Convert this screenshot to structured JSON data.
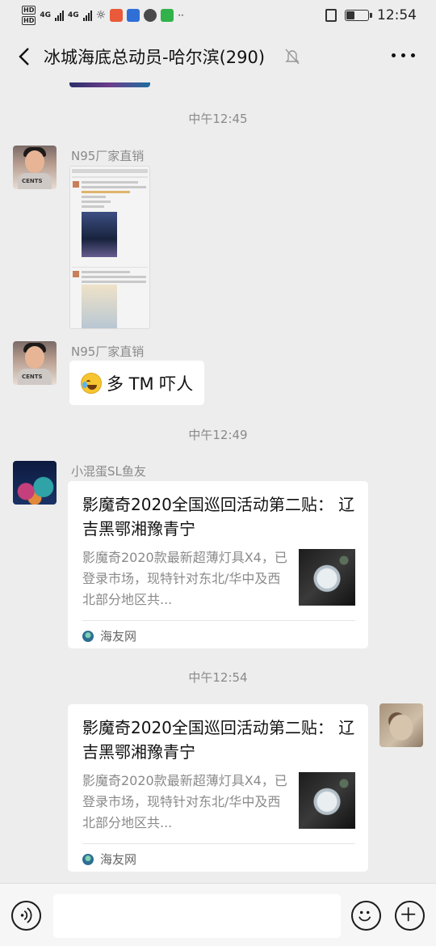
{
  "status_bar": {
    "hd1": "HD",
    "hd2": "HD",
    "net1": "4G",
    "net2": "4G",
    "time": "12:54",
    "battery_level": 0.35
  },
  "header": {
    "title": "冰城海底总动员-哈尔滨(290)",
    "back_icon": "chevron-left-icon",
    "mute_icon": "bell-off-icon",
    "more_icon": "ellipsis-icon"
  },
  "messages": [
    {
      "type": "time",
      "text": "中午12:45"
    },
    {
      "type": "image",
      "sender": "N95厂家直销",
      "avatar_shirt": "CENTS",
      "description": "screenshot"
    },
    {
      "type": "text",
      "sender": "N95厂家直销",
      "avatar_shirt": "CENTS",
      "emoji": "rofl-emoji",
      "text": "多 TM 吓人"
    },
    {
      "type": "time",
      "text": "中午12:49"
    },
    {
      "type": "link",
      "sender": "小混蛋SL鱼友",
      "title": "影魔奇2020全国巡回活动第二贴：  辽吉黑鄂湘豫青宁",
      "desc": "影魔奇2020款最新超薄灯具X4，已登录市场，现特针对东北/华中及西北部分地区共...",
      "source": "海友网"
    },
    {
      "type": "time",
      "text": "中午12:54"
    },
    {
      "type": "link",
      "sender": "me",
      "title": "影魔奇2020全国巡回活动第二贴：  辽吉黑鄂湘豫青宁",
      "desc": "影魔奇2020款最新超薄灯具X4，已登录市场，现特针对东北/华中及西北部分地区共...",
      "source": "海友网"
    }
  ],
  "input_bar": {
    "voice_icon": "voice-icon",
    "emoji_icon": "smiley-icon",
    "plus_icon": "plus-icon",
    "input_value": ""
  }
}
